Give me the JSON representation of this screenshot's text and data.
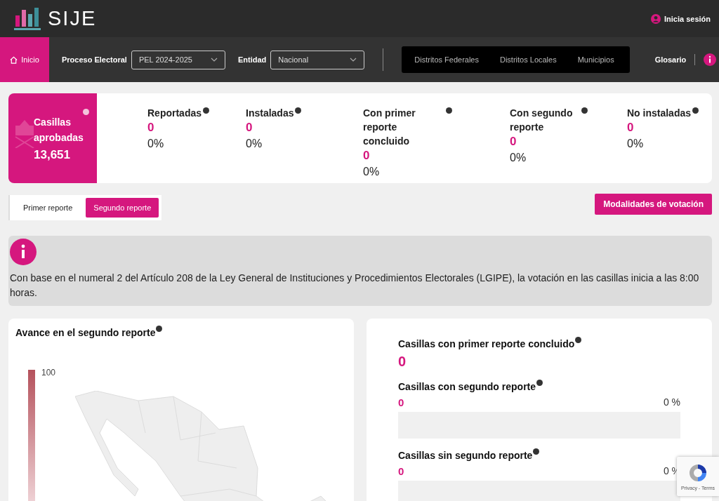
{
  "header": {
    "logo_text": "SIJE",
    "login": "Inicia sesión"
  },
  "nav": {
    "home": {
      "label": "Inicio",
      "selected": true
    },
    "fields": [
      {
        "label": "Proceso Electoral",
        "value": "PEL 2024-2025"
      },
      {
        "label": "Entidad",
        "value": "Nacional"
      }
    ],
    "views": [
      "Distritos Federales",
      "Distritos Locales",
      "Municipios"
    ],
    "glossary": "Glosario"
  },
  "summary": {
    "title": "Casillas aprobadas",
    "total": "13,651",
    "items": [
      {
        "label": "Reportadas",
        "value": "0",
        "percent": "0%"
      },
      {
        "label": "Instaladas",
        "value": "0",
        "percent": "0%"
      },
      {
        "label": "Con primer reporte concluido",
        "value": "0",
        "percent": "0%"
      },
      {
        "label": "Con segundo reporte",
        "value": "0",
        "percent": "0%"
      },
      {
        "label": "No instaladas",
        "value": "0",
        "percent": "0%"
      }
    ]
  },
  "report_tabs": [
    {
      "label": "Primer reporte",
      "selected": false
    },
    {
      "label": "Segundo reporte",
      "selected": true
    }
  ],
  "modalities_button": "Modalidades de votación",
  "notice": "Con base en el numeral 2 del Artículo 208 de la Ley General de Instituciones y Procedimientos Electorales (LGIPE), la votación en las casillas inicia a las 8:00 horas.",
  "map_card": {
    "title": "Avance en el segundo reporte",
    "legend_max": "100"
  },
  "stats_card": {
    "items": [
      {
        "kind": "plain",
        "label": "Casillas con primer reporte concluido",
        "value": "0"
      },
      {
        "kind": "bar",
        "label": "Casillas con segundo reporte",
        "value": "0",
        "percent": "0 %"
      },
      {
        "kind": "bar",
        "label": "Casillas sin segundo reporte",
        "value": "0",
        "percent": "0 %"
      }
    ]
  },
  "recaptcha": {
    "text": "Privacy - Terms"
  }
}
